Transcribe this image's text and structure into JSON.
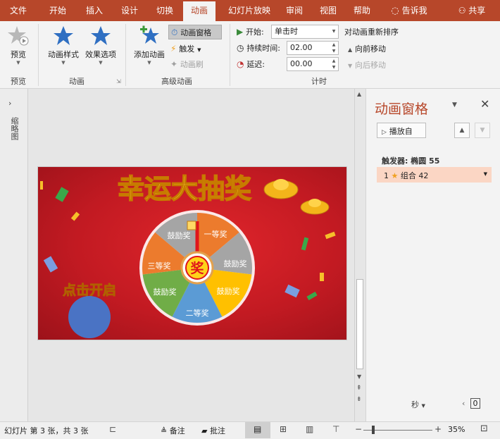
{
  "tabs": [
    "文件",
    "开始",
    "插入",
    "设计",
    "切换",
    "动画",
    "幻灯片放映",
    "审阅",
    "视图",
    "帮助",
    "告诉我",
    "共享"
  ],
  "ribbon": {
    "preview": "预览",
    "preview_group": "预览",
    "anim_style": "动画样式",
    "effect_opts": "效果选项",
    "anim_group": "动画",
    "add_anim": "添加动画",
    "anim_pane": "动画窗格",
    "trigger": "触发",
    "anim_brush": "动画刷",
    "adv_group": "高级动画",
    "start_label": "开始:",
    "start_value": "单击时",
    "duration_label": "持续时间:",
    "duration_value": "02.00",
    "delay_label": "延迟:",
    "delay_value": "00.00",
    "timing_group": "计时",
    "reorder_title": "对动画重新排序",
    "move_fwd": "向前移动",
    "move_back": "向后移动"
  },
  "thumbs_label": "缩略图",
  "slide": {
    "title": "幸运大抽奖",
    "center": "奖",
    "click_start": "点击开启",
    "segments": [
      "一等奖",
      "鼓励奖",
      "鼓励奖",
      "二等奖",
      "鼓励奖",
      "三等奖",
      "鼓励奖"
    ]
  },
  "pane": {
    "title": "动画窗格",
    "play_from": "播放自",
    "trigger_label": "触发器: 椭圆 55",
    "item_num": "1",
    "item_label": "组合 42",
    "seconds": "秒",
    "zoom_box": "0"
  },
  "status": {
    "slide_info": "幻灯片 第 3 张，共 3 张",
    "notes": "备注",
    "comments": "批注",
    "zoom": "35%"
  },
  "colors": {
    "accent": "#b7472a",
    "highlight": "#fbd6c4",
    "slide_bg": "#c21a22"
  }
}
